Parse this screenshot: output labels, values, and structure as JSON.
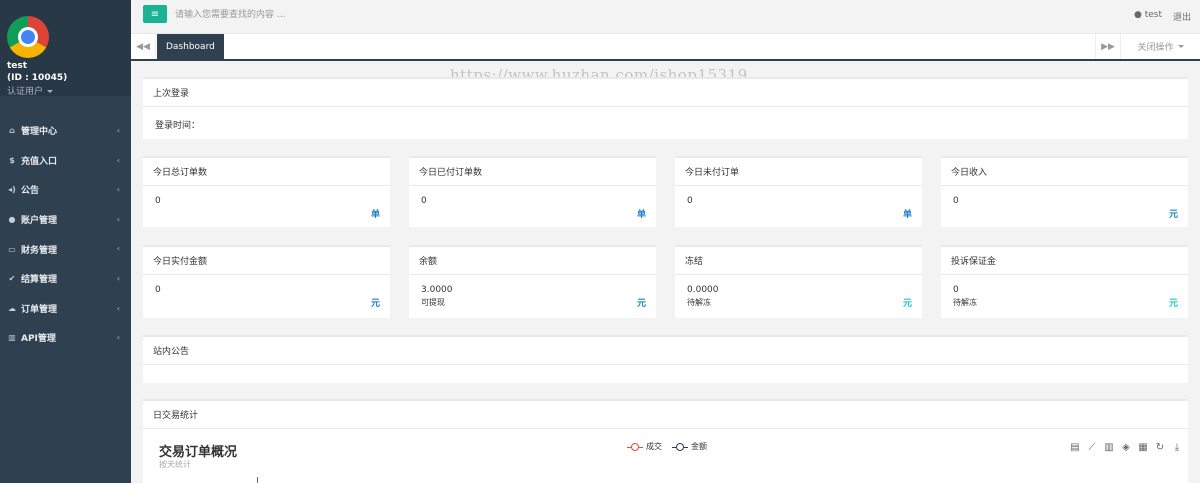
{
  "profile": {
    "username": "test",
    "id_text": "(ID : 10045)",
    "role": "认证用户"
  },
  "sidebar": {
    "items": [
      {
        "icon": "home-icon",
        "glyph": "⌂",
        "label": "管理中心"
      },
      {
        "icon": "dollar-icon",
        "glyph": "$",
        "label": "充值入口"
      },
      {
        "icon": "volume-icon",
        "glyph": "◂)",
        "label": "公告"
      },
      {
        "icon": "user-icon",
        "glyph": "●",
        "label": "账户管理"
      },
      {
        "icon": "money-icon",
        "glyph": "▭",
        "label": "财务管理"
      },
      {
        "icon": "check-icon",
        "glyph": "✔",
        "label": "结算管理"
      },
      {
        "icon": "cloud-icon",
        "glyph": "☁",
        "label": "订单管理"
      },
      {
        "icon": "bank-icon",
        "glyph": "▥",
        "label": "API管理"
      }
    ]
  },
  "topbar": {
    "search_placeholder": "请输入您需要查找的内容 ...",
    "user": "test",
    "logout": "退出"
  },
  "tabs": {
    "active": "Dashboard",
    "close_ops": "关闭操作"
  },
  "watermark": "https://www.huzhan.com/ishop15319",
  "last_login": {
    "title": "上次登录",
    "label": "登录时间："
  },
  "stats_row1": [
    {
      "title": "今日总订单数",
      "value": "0",
      "unit": "单"
    },
    {
      "title": "今日已付订单数",
      "value": "0",
      "unit": "单"
    },
    {
      "title": "今日未付订单",
      "value": "0",
      "unit": "单"
    },
    {
      "title": "今日收入",
      "value": "0",
      "unit": "元"
    }
  ],
  "stats_row2": [
    {
      "title": "今日实付金额",
      "value": "0",
      "sub": "",
      "unit": "元"
    },
    {
      "title": "余额",
      "value": "3.0000",
      "sub": "可提现",
      "unit": "元"
    },
    {
      "title": "冻结",
      "value": "0.0000",
      "sub": "待解冻",
      "unit": "元"
    },
    {
      "title": "投诉保证金",
      "value": "0",
      "sub": "待解冻",
      "unit": "元"
    }
  ],
  "announcement": {
    "title": "站内公告"
  },
  "daily_stats": {
    "title": "日交易统计",
    "chart_title": "交易订单概况",
    "chart_subtitle": "按天统计",
    "legend": [
      {
        "name": "成交",
        "color": "#e74c3c"
      },
      {
        "name": "金额",
        "color": "#2f4050"
      }
    ],
    "tools": [
      "data-view-icon",
      "line-chart-icon",
      "bar-chart-icon",
      "stack-icon",
      "tiled-icon",
      "refresh-icon",
      "download-icon"
    ]
  },
  "colors": {
    "accent": "#1ab394",
    "sidebar": "#2f4050",
    "unit_blue": "#1c84c6",
    "unit_cyan": "#23c6c8"
  }
}
